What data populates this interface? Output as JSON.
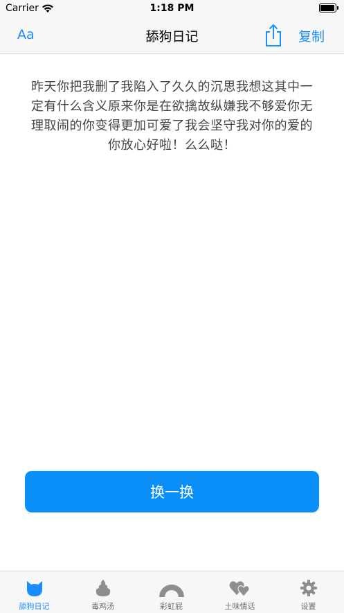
{
  "status": {
    "carrier": "Carrier",
    "time": "1:18 PM"
  },
  "nav": {
    "left_label": "Aa",
    "title": "舔狗日记",
    "share_icon": "share-icon",
    "copy_label": "复制"
  },
  "content": {
    "text": "昨天你把我删了我陷入了久久的沉思我想这其中一定有什么含义原来你是在欲擒故纵嫌我不够爱你无理取闹的你变得更加可爱了我会坚守我对你的爱的你放心好啦！么么哒！"
  },
  "button": {
    "label": "换一换"
  },
  "tabs": [
    {
      "label": "舔狗日记",
      "icon": "cat-icon",
      "active": true
    },
    {
      "label": "毒鸡汤",
      "icon": "poop-icon",
      "active": false
    },
    {
      "label": "彩虹屁",
      "icon": "rainbow-icon",
      "active": false
    },
    {
      "label": "土味情话",
      "icon": "hearts-icon",
      "active": false
    },
    {
      "label": "设置",
      "icon": "gear-icon",
      "active": false
    }
  ],
  "colors": {
    "accent": "#1a8cff",
    "button": "#0a8ef7",
    "inactive": "#8e8e8e"
  }
}
